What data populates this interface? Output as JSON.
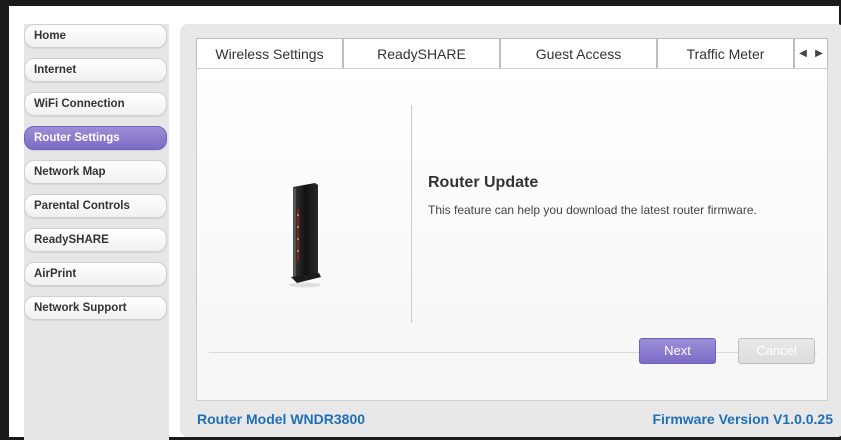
{
  "sidebar": {
    "items": [
      {
        "label": "Home",
        "active": false
      },
      {
        "label": "Internet",
        "active": false
      },
      {
        "label": "WiFi Connection",
        "active": false
      },
      {
        "label": "Router Settings",
        "active": true
      },
      {
        "label": "Network Map",
        "active": false
      },
      {
        "label": "Parental Controls",
        "active": false
      },
      {
        "label": "ReadySHARE",
        "active": false
      },
      {
        "label": "AirPrint",
        "active": false
      },
      {
        "label": "Network Support",
        "active": false
      }
    ]
  },
  "tabs": [
    {
      "label": "Wireless Settings"
    },
    {
      "label": "ReadySHARE"
    },
    {
      "label": "Guest Access"
    },
    {
      "label": "Traffic Meter"
    }
  ],
  "tab_scroll": {
    "left_icon": "chevron-left-icon",
    "right_icon": "chevron-right-icon"
  },
  "content": {
    "title": "Router Update",
    "description": "This feature can help you download the latest router firmware.",
    "image_icon": "router-device-icon"
  },
  "buttons": {
    "next_label": "Next",
    "cancel_label": "Cancel"
  },
  "footer": {
    "model": "Router Model WNDR3800",
    "firmware": "Firmware Version V1.0.0.25"
  },
  "colors": {
    "accent": "#8a7bd0",
    "footer_text": "#1f6fb8"
  }
}
